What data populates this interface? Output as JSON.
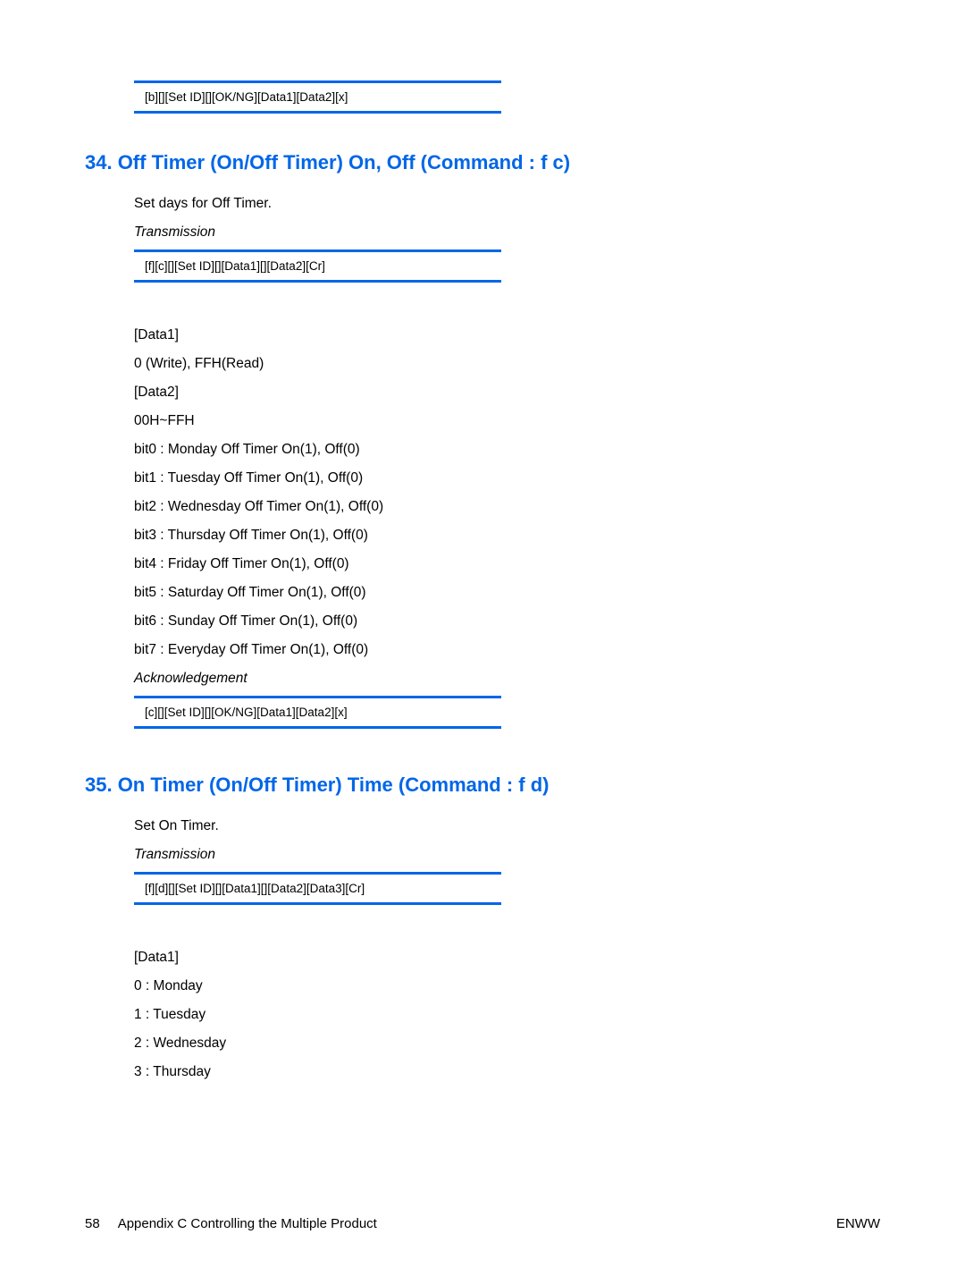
{
  "intro_cell": "[b][][Set ID][][OK/NG][Data1][Data2][x]",
  "section34": {
    "title": "34. Off Timer (On/Off Timer) On, Off (Command : f c)",
    "desc": "Set days for Off Timer.",
    "transmission_label": "Transmission",
    "transmission_cell": "[f][c][][Set ID][][Data1][][Data2][Cr]",
    "lines": [
      "[Data1]",
      "0 (Write), FFH(Read)",
      "[Data2]",
      "00H~FFH",
      "bit0 : Monday Off Timer On(1), Off(0)",
      "bit1 : Tuesday Off Timer On(1), Off(0)",
      "bit2 : Wednesday Off Timer On(1), Off(0)",
      "bit3 : Thursday Off Timer On(1), Off(0)",
      "bit4 : Friday Off Timer On(1), Off(0)",
      "bit5 : Saturday Off Timer On(1), Off(0)",
      "bit6 : Sunday Off Timer On(1), Off(0)",
      "bit7 : Everyday Off Timer On(1), Off(0)"
    ],
    "ack_label": "Acknowledgement",
    "ack_cell": "[c][][Set ID][][OK/NG][Data1][Data2][x]"
  },
  "section35": {
    "title": "35. On Timer (On/Off Timer) Time (Command : f d)",
    "desc": "Set On Timer.",
    "transmission_label": "Transmission",
    "transmission_cell": "[f][d][][Set ID][][Data1][][Data2][Data3][Cr]",
    "lines": [
      "[Data1]",
      "0 : Monday",
      "1 : Tuesday",
      "2 : Wednesday",
      "3 : Thursday"
    ]
  },
  "footer": {
    "page_num": "58",
    "appendix": "Appendix C   Controlling the Multiple Product",
    "enww": "ENWW"
  }
}
